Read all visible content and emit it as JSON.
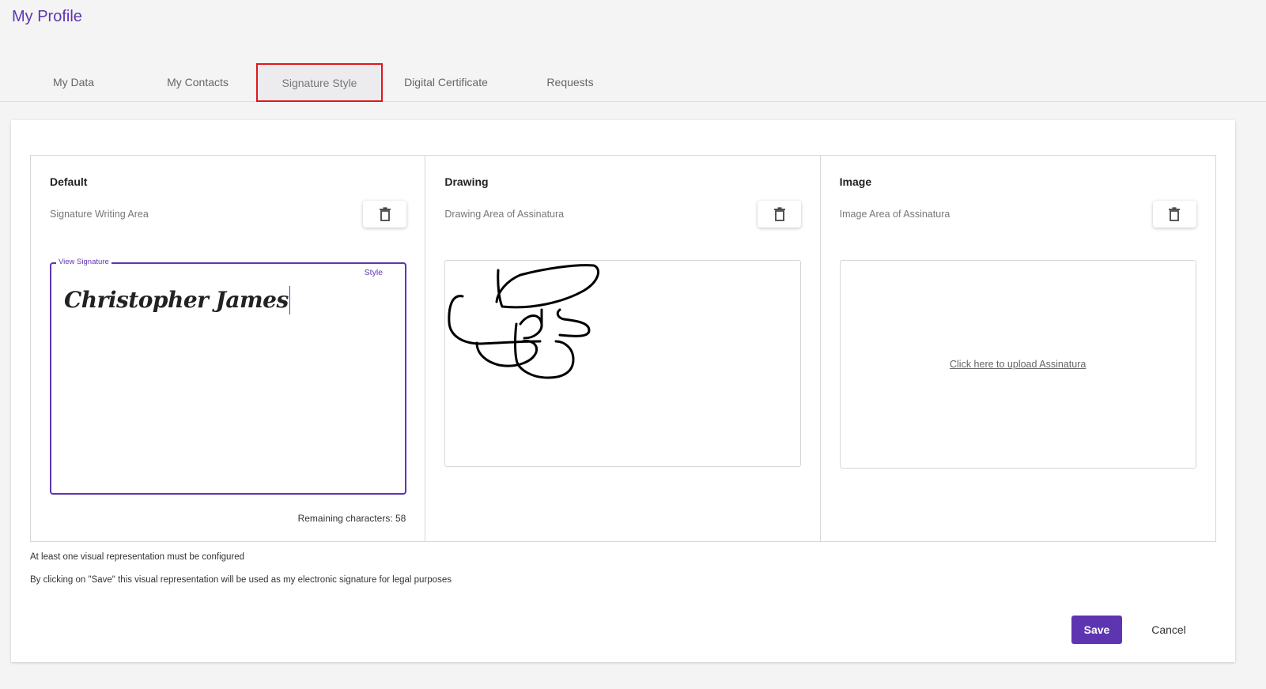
{
  "page": {
    "title": "My Profile"
  },
  "tabs": [
    {
      "label": "My Data",
      "active": false
    },
    {
      "label": "My Contacts",
      "active": false
    },
    {
      "label": "Signature Style",
      "active": true
    },
    {
      "label": "Digital Certificate",
      "active": false
    },
    {
      "label": "Requests",
      "active": false
    }
  ],
  "panels": {
    "default": {
      "title": "Default",
      "subtitle": "Signature Writing Area",
      "legend": "View Signature",
      "style_label": "Style",
      "signature_text": "Christopher James",
      "remaining_label": "Remaining characters: 58"
    },
    "drawing": {
      "title": "Drawing",
      "subtitle": "Drawing Area of Assinatura"
    },
    "image": {
      "title": "Image",
      "subtitle": "Image Area of Assinatura",
      "upload_label": "Click here to upload Assinatura"
    }
  },
  "notes": {
    "line1": "At least one visual representation must be configured",
    "line2": "By clicking on \"Save\" this visual representation will be used as my electronic signature for legal purposes"
  },
  "actions": {
    "save_label": "Save",
    "cancel_label": "Cancel"
  },
  "colors": {
    "accent": "#5e35b1",
    "active_tab_border": "#e0161b"
  },
  "icons": {
    "delete": "trash-icon"
  }
}
